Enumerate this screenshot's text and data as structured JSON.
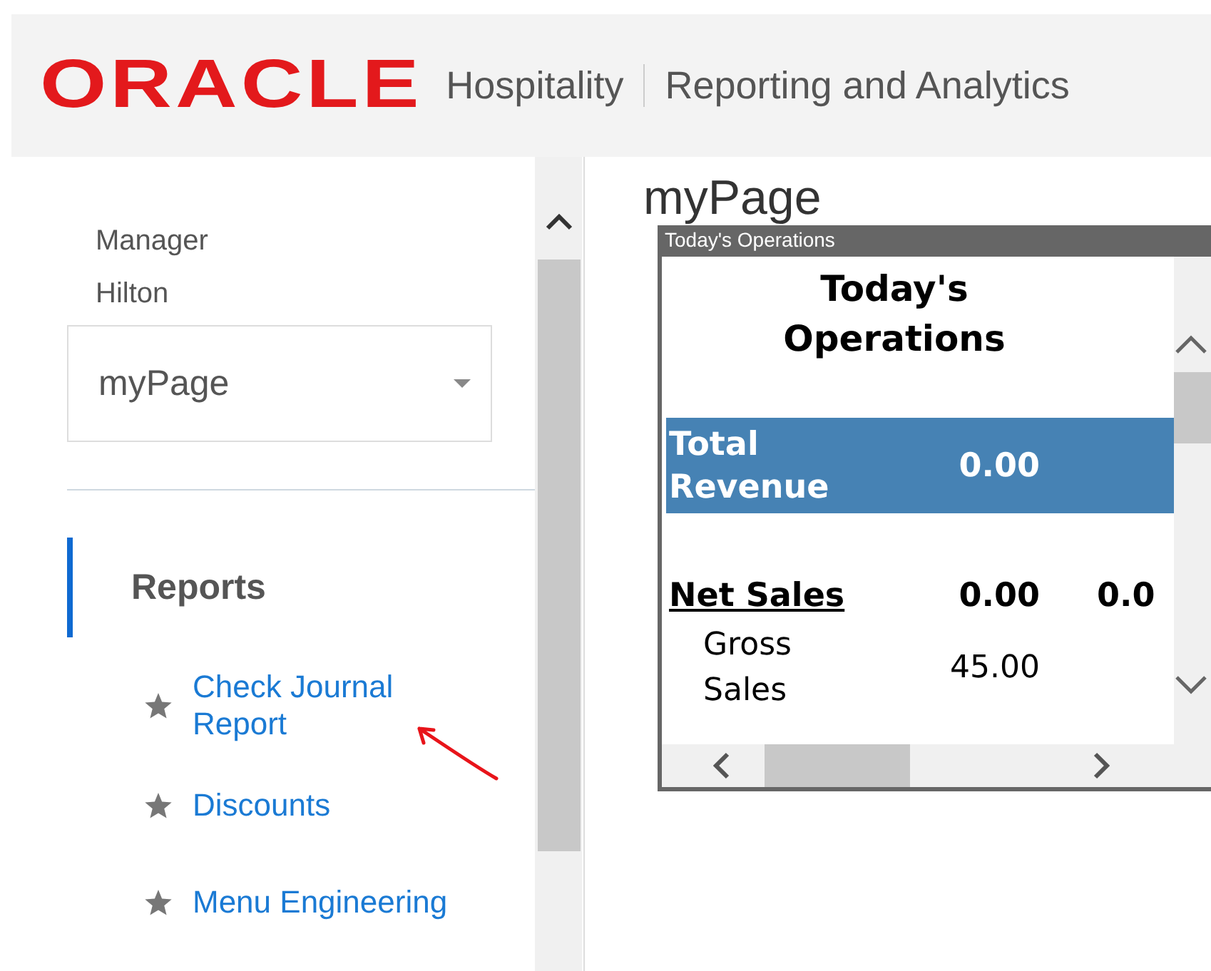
{
  "header": {
    "logo": "ORACLE",
    "product": "Hospitality",
    "app": "Reporting and Analytics"
  },
  "sidebar": {
    "role": "Manager",
    "location": "Hilton",
    "page_select": {
      "value": "myPage"
    },
    "section": {
      "label": "Reports",
      "selected": true
    },
    "items": [
      {
        "label": "Check Journal Report",
        "annotated": true
      },
      {
        "label": "Discounts",
        "annotated": false
      },
      {
        "label": "Menu Engineering",
        "annotated": false
      }
    ]
  },
  "main": {
    "title": "myPage",
    "widget": {
      "title": "Today's Operations",
      "heading": "Today's Operations",
      "rows": [
        {
          "kind": "total",
          "label": "Total Revenue",
          "values": [
            "0.00"
          ]
        },
        {
          "kind": "section",
          "label": "Net Sales",
          "values": [
            "0.00",
            "0.0"
          ]
        },
        {
          "kind": "item",
          "label": "Gross Sales",
          "values": [
            "45.00"
          ]
        }
      ]
    }
  }
}
